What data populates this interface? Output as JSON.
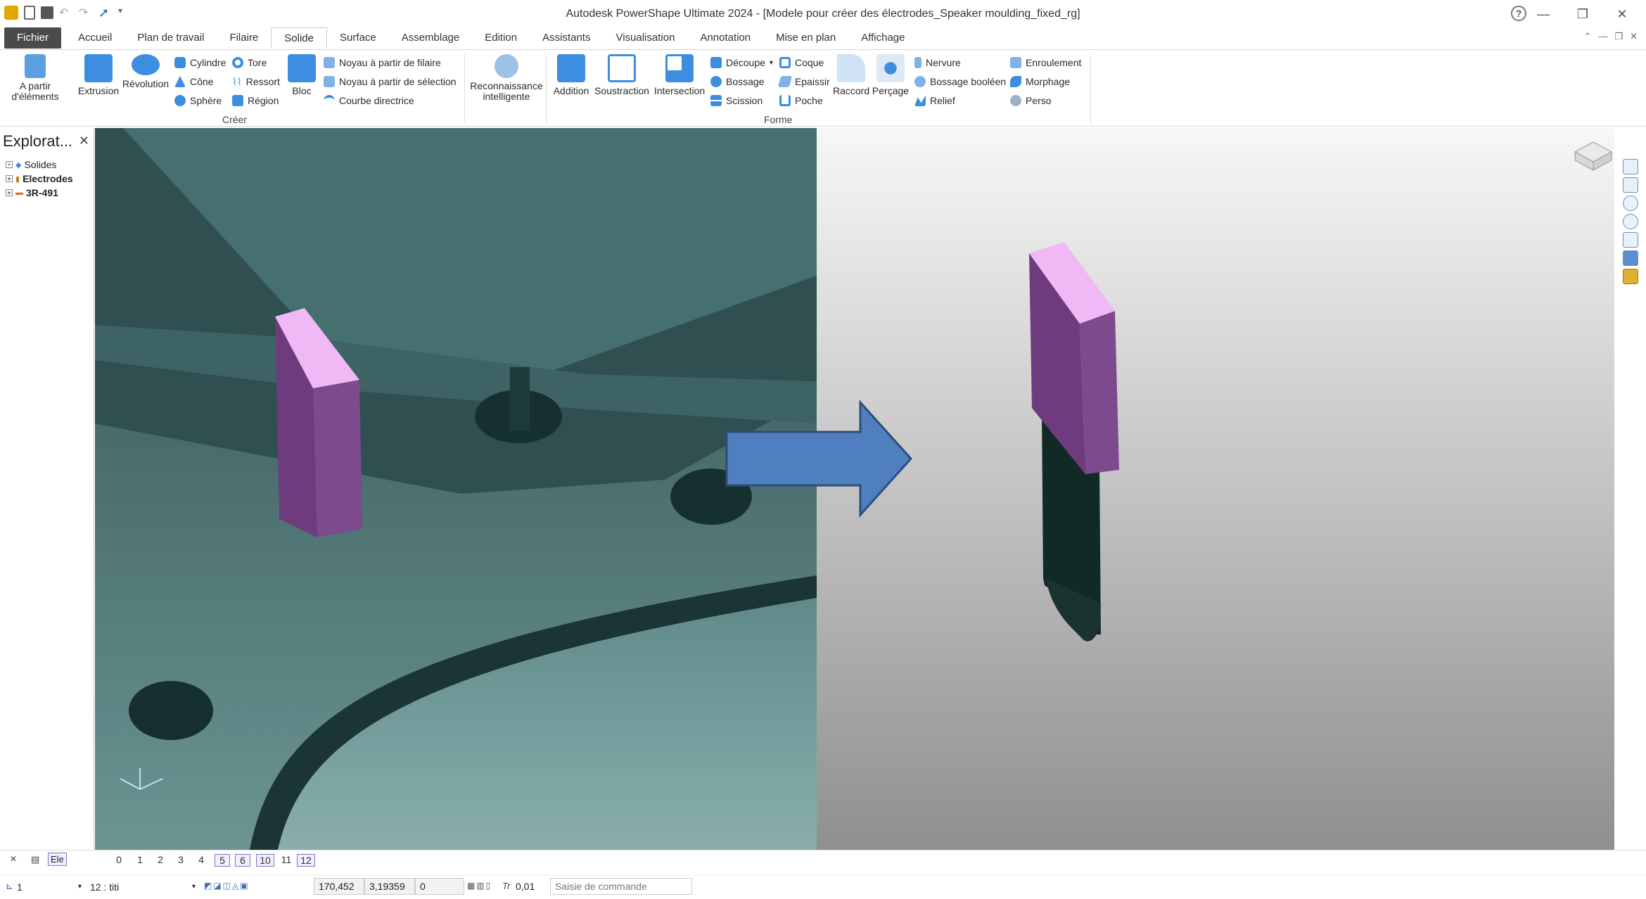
{
  "app": {
    "title": "Autodesk PowerShape Ultimate 2024 - [Modele pour créer des électrodes_Speaker moulding_fixed_rg]"
  },
  "window": {
    "min": "—",
    "restore": "❐",
    "close": "✕",
    "help": "?"
  },
  "ribbon_ctrls": [
    "⌃",
    "—",
    "❐",
    "✕"
  ],
  "tabs": [
    {
      "label": "Fichier"
    },
    {
      "label": "Accueil"
    },
    {
      "label": "Plan de travail"
    },
    {
      "label": "Filaire"
    },
    {
      "label": "Solide"
    },
    {
      "label": "Surface"
    },
    {
      "label": "Assemblage"
    },
    {
      "label": "Edition"
    },
    {
      "label": "Assistants"
    },
    {
      "label": "Visualisation"
    },
    {
      "label": "Annotation"
    },
    {
      "label": "Mise en plan"
    },
    {
      "label": "Affichage"
    }
  ],
  "ribbon": {
    "apartir_label": "A partir d'éléments",
    "extrusion": "Extrusion",
    "revolution": "Révolution",
    "cylindre": "Cylindre",
    "cone": "Cône",
    "sphere": "Sphère",
    "tore": "Tore",
    "ressort": "Ressort",
    "region": "Région",
    "bloc": "Bloc",
    "noyau_filaire": "Noyau à partir de filaire",
    "noyau_selection": "Noyau à partir de sélection",
    "courbe_directrice": "Courbe directrice",
    "creer_group": "Créer",
    "reconnaissance": "Reconnaissance intelligente",
    "addition": "Addition",
    "soustraction": "Soustraction",
    "intersection": "Intersection",
    "decoupe": "Découpe",
    "bossage": "Bossage",
    "scission": "Scission",
    "coque": "Coque",
    "epaissir": "Epaissir",
    "poche": "Poche",
    "raccord": "Raccord",
    "percage": "Perçage",
    "nervure": "Nervure",
    "bossage_booleen": "Bossage booléen",
    "relief": "Relief",
    "enroulement": "Enroulement",
    "morphage": "Morphage",
    "perso": "Perso",
    "forme_group": "Forme"
  },
  "explorer": {
    "title": "Explorat...",
    "items": [
      "Solides",
      "Electrodes",
      "3R-491"
    ]
  },
  "levels": {
    "prefix_label": "Ele",
    "numbers": [
      "0",
      "1",
      "2",
      "3",
      "4",
      "5",
      "6",
      "10",
      "11",
      "12"
    ]
  },
  "cmd": {
    "workplane": "1",
    "level": "12  : titi",
    "x": "170,452",
    "y": "3,19359",
    "z": "0",
    "tol": "0,01",
    "command_placeholder": "Saisie de commande"
  },
  "colors": {
    "electrode_top": "#f0b8f4",
    "electrode_front": "#6e3c7e",
    "electrode_side": "#8a5a96",
    "mould": "#4e7a79",
    "arrow": "#4f7fbf"
  }
}
